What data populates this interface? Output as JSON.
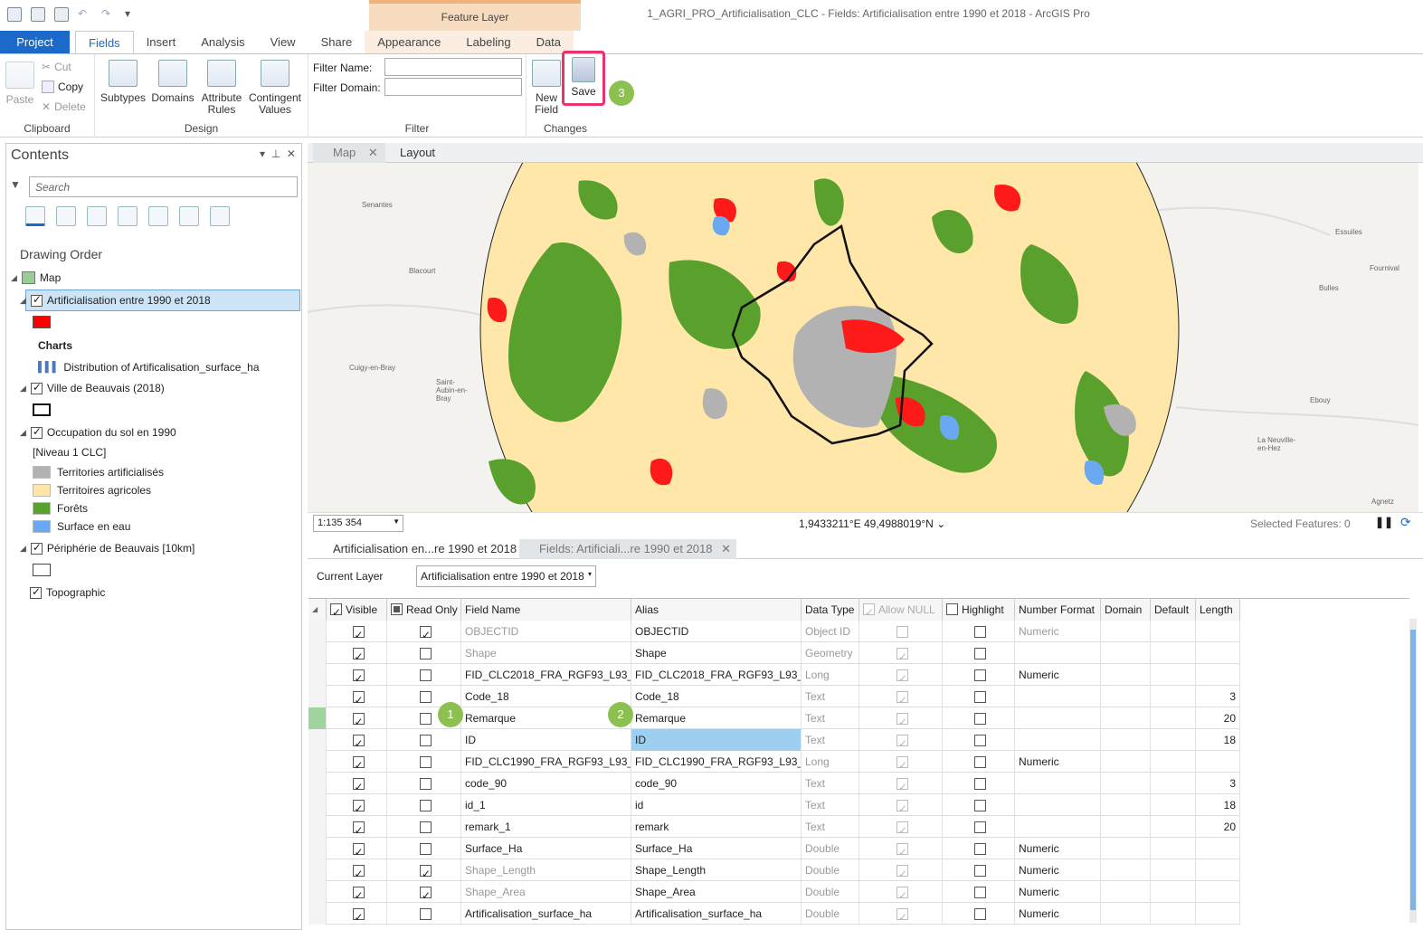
{
  "app": {
    "title": "1_AGRI_PRO_Artificialisation_CLC - Fields:  Artificialisation entre 1990 et 2018 - ArcGIS Pro",
    "context_tab_group": "Feature Layer"
  },
  "tabs": [
    "Project",
    "Fields",
    "Insert",
    "Analysis",
    "View",
    "Share",
    "Appearance",
    "Labeling",
    "Data"
  ],
  "ribbon": {
    "clipboard": {
      "paste": "Paste",
      "cut": "Cut",
      "copy": "Copy",
      "delete": "Delete",
      "label": "Clipboard"
    },
    "design": {
      "subtypes": "Subtypes",
      "domains": "Domains",
      "attribute_rules": "Attribute Rules",
      "contingent_values": "Contingent Values",
      "label": "Design"
    },
    "filter": {
      "filter_name": "Filter Name:",
      "filter_domain": "Filter Domain:",
      "label": "Filter"
    },
    "changes": {
      "new_field": "New Field",
      "save": "Save",
      "label": "Changes"
    }
  },
  "badges": [
    "1",
    "2",
    "3"
  ],
  "contents": {
    "title": "Contents",
    "search_placeholder": "Search",
    "drawing_order": "Drawing Order",
    "map": "Map",
    "layer1": "Artificialisation entre 1990 et 2018",
    "charts": "Charts",
    "chart_item": "Distribution of Artificalisation_surface_ha",
    "layer2": "Ville de Beauvais (2018)",
    "layer3": "Occupation du sol en 1990",
    "layer3_group": "[Niveau 1 CLC]",
    "legend": [
      {
        "label": "Territories artificialisés",
        "color": "#b2b2b2"
      },
      {
        "label": "Territoires agricoles",
        "color": "#ffe6a8"
      },
      {
        "label": "Forêts",
        "color": "#5aa02c"
      },
      {
        "label": "Surface en eau",
        "color": "#6aa9f2"
      }
    ],
    "layer4": "Périphérie de Beauvais [10km]",
    "layer5": "Topographic"
  },
  "view_tabs": {
    "map": "Map",
    "layout": "Layout"
  },
  "map": {
    "places": [
      "Senantes",
      "Blacourt",
      "Cuigy-en-Bray",
      "Saint-Aubin-en-Bray",
      "Bulles",
      "Fournival",
      "Essuiles",
      "Ebouy",
      "La Neuville-en-Hez",
      "Agnetz"
    ],
    "scale": "1:135 354",
    "coords": "1,9433211°E 49,4988019°N",
    "selected": "Selected Features: 0"
  },
  "table_tabs": {
    "table": "Artificialisation en...re 1990 et 2018",
    "fields": "Fields:  Artificiali...re 1990 et 2018"
  },
  "current_layer": {
    "label": "Current Layer",
    "value": "Artificialisation entre 1990 et 2018"
  },
  "fields": {
    "headers": [
      "Visible",
      "Read Only",
      "Field Name",
      "Alias",
      "Data Type",
      "Allow NULL",
      "Highlight",
      "Number Format",
      "Domain",
      "Default",
      "Length"
    ],
    "rows": [
      {
        "name": "OBJECTID",
        "alias": "OBJECTID",
        "type": "Object ID",
        "fmt": "Numeric",
        "len": "",
        "ro": true,
        "greyname": true
      },
      {
        "name": "Shape",
        "alias": "Shape",
        "type": "Geometry",
        "fmt": "",
        "len": "",
        "ro": false,
        "greyname": true
      },
      {
        "name": "FID_CLC2018_FRA_RGF93_L93_Oise",
        "alias": "FID_CLC2018_FRA_RGF93_L93_Oise",
        "type": "Long",
        "fmt": "Numeric",
        "len": "",
        "ro": false,
        "greyname": false
      },
      {
        "name": "Code_18",
        "alias": "Code_18",
        "type": "Text",
        "fmt": "",
        "len": "3",
        "ro": false,
        "greyname": false
      },
      {
        "name": "Remarque",
        "alias": "Remarque",
        "type": "Text",
        "fmt": "",
        "len": "20",
        "ro": false,
        "greyname": false
      },
      {
        "name": "ID",
        "alias": "ID",
        "type": "Text",
        "fmt": "",
        "len": "18",
        "ro": false,
        "greyname": false
      },
      {
        "name": "FID_CLC1990_FRA_RGF93_L93_Oise",
        "alias": "FID_CLC1990_FRA_RGF93_L93_Oise",
        "type": "Long",
        "fmt": "Numeric",
        "len": "",
        "ro": false,
        "greyname": false
      },
      {
        "name": "code_90",
        "alias": "code_90",
        "type": "Text",
        "fmt": "",
        "len": "3",
        "ro": false,
        "greyname": false
      },
      {
        "name": "id_1",
        "alias": "id",
        "type": "Text",
        "fmt": "",
        "len": "18",
        "ro": false,
        "greyname": false
      },
      {
        "name": "remark_1",
        "alias": "remark",
        "type": "Text",
        "fmt": "",
        "len": "20",
        "ro": false,
        "greyname": false
      },
      {
        "name": "Surface_Ha",
        "alias": "Surface_Ha",
        "type": "Double",
        "fmt": "Numeric",
        "len": "",
        "ro": false,
        "greyname": false
      },
      {
        "name": "Shape_Length",
        "alias": "Shape_Length",
        "type": "Double",
        "fmt": "Numeric",
        "len": "",
        "ro": true,
        "greyname": true
      },
      {
        "name": "Shape_Area",
        "alias": "Shape_Area",
        "type": "Double",
        "fmt": "Numeric",
        "len": "",
        "ro": true,
        "greyname": true
      },
      {
        "name": "Artificalisation_surface_ha",
        "alias": "Artificalisation_surface_ha",
        "type": "Double",
        "fmt": "Numeric",
        "len": "",
        "ro": false,
        "greyname": false
      }
    ]
  }
}
